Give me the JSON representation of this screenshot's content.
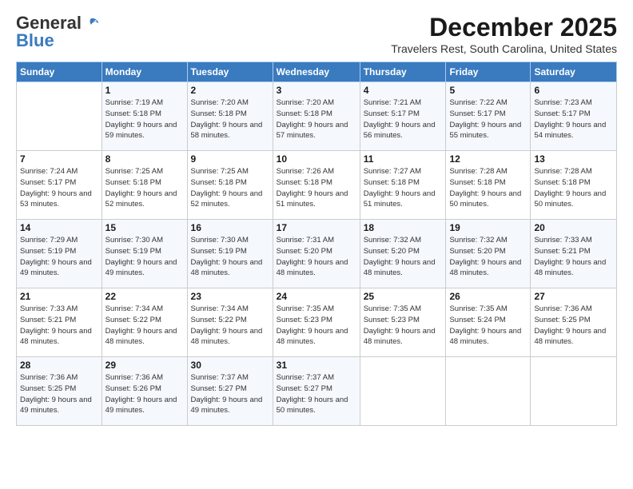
{
  "logo": {
    "general": "General",
    "blue": "Blue"
  },
  "header": {
    "month": "December 2025",
    "location": "Travelers Rest, South Carolina, United States"
  },
  "weekdays": [
    "Sunday",
    "Monday",
    "Tuesday",
    "Wednesday",
    "Thursday",
    "Friday",
    "Saturday"
  ],
  "weeks": [
    [
      {
        "day": "",
        "info": ""
      },
      {
        "day": "1",
        "info": "Sunrise: 7:19 AM\nSunset: 5:18 PM\nDaylight: 9 hours\nand 59 minutes."
      },
      {
        "day": "2",
        "info": "Sunrise: 7:20 AM\nSunset: 5:18 PM\nDaylight: 9 hours\nand 58 minutes."
      },
      {
        "day": "3",
        "info": "Sunrise: 7:20 AM\nSunset: 5:18 PM\nDaylight: 9 hours\nand 57 minutes."
      },
      {
        "day": "4",
        "info": "Sunrise: 7:21 AM\nSunset: 5:17 PM\nDaylight: 9 hours\nand 56 minutes."
      },
      {
        "day": "5",
        "info": "Sunrise: 7:22 AM\nSunset: 5:17 PM\nDaylight: 9 hours\nand 55 minutes."
      },
      {
        "day": "6",
        "info": "Sunrise: 7:23 AM\nSunset: 5:17 PM\nDaylight: 9 hours\nand 54 minutes."
      }
    ],
    [
      {
        "day": "7",
        "info": "Sunrise: 7:24 AM\nSunset: 5:17 PM\nDaylight: 9 hours\nand 53 minutes."
      },
      {
        "day": "8",
        "info": "Sunrise: 7:25 AM\nSunset: 5:18 PM\nDaylight: 9 hours\nand 52 minutes."
      },
      {
        "day": "9",
        "info": "Sunrise: 7:25 AM\nSunset: 5:18 PM\nDaylight: 9 hours\nand 52 minutes."
      },
      {
        "day": "10",
        "info": "Sunrise: 7:26 AM\nSunset: 5:18 PM\nDaylight: 9 hours\nand 51 minutes."
      },
      {
        "day": "11",
        "info": "Sunrise: 7:27 AM\nSunset: 5:18 PM\nDaylight: 9 hours\nand 51 minutes."
      },
      {
        "day": "12",
        "info": "Sunrise: 7:28 AM\nSunset: 5:18 PM\nDaylight: 9 hours\nand 50 minutes."
      },
      {
        "day": "13",
        "info": "Sunrise: 7:28 AM\nSunset: 5:18 PM\nDaylight: 9 hours\nand 50 minutes."
      }
    ],
    [
      {
        "day": "14",
        "info": "Sunrise: 7:29 AM\nSunset: 5:19 PM\nDaylight: 9 hours\nand 49 minutes."
      },
      {
        "day": "15",
        "info": "Sunrise: 7:30 AM\nSunset: 5:19 PM\nDaylight: 9 hours\nand 49 minutes."
      },
      {
        "day": "16",
        "info": "Sunrise: 7:30 AM\nSunset: 5:19 PM\nDaylight: 9 hours\nand 48 minutes."
      },
      {
        "day": "17",
        "info": "Sunrise: 7:31 AM\nSunset: 5:20 PM\nDaylight: 9 hours\nand 48 minutes."
      },
      {
        "day": "18",
        "info": "Sunrise: 7:32 AM\nSunset: 5:20 PM\nDaylight: 9 hours\nand 48 minutes."
      },
      {
        "day": "19",
        "info": "Sunrise: 7:32 AM\nSunset: 5:20 PM\nDaylight: 9 hours\nand 48 minutes."
      },
      {
        "day": "20",
        "info": "Sunrise: 7:33 AM\nSunset: 5:21 PM\nDaylight: 9 hours\nand 48 minutes."
      }
    ],
    [
      {
        "day": "21",
        "info": "Sunrise: 7:33 AM\nSunset: 5:21 PM\nDaylight: 9 hours\nand 48 minutes."
      },
      {
        "day": "22",
        "info": "Sunrise: 7:34 AM\nSunset: 5:22 PM\nDaylight: 9 hours\nand 48 minutes."
      },
      {
        "day": "23",
        "info": "Sunrise: 7:34 AM\nSunset: 5:22 PM\nDaylight: 9 hours\nand 48 minutes."
      },
      {
        "day": "24",
        "info": "Sunrise: 7:35 AM\nSunset: 5:23 PM\nDaylight: 9 hours\nand 48 minutes."
      },
      {
        "day": "25",
        "info": "Sunrise: 7:35 AM\nSunset: 5:23 PM\nDaylight: 9 hours\nand 48 minutes."
      },
      {
        "day": "26",
        "info": "Sunrise: 7:35 AM\nSunset: 5:24 PM\nDaylight: 9 hours\nand 48 minutes."
      },
      {
        "day": "27",
        "info": "Sunrise: 7:36 AM\nSunset: 5:25 PM\nDaylight: 9 hours\nand 48 minutes."
      }
    ],
    [
      {
        "day": "28",
        "info": "Sunrise: 7:36 AM\nSunset: 5:25 PM\nDaylight: 9 hours\nand 49 minutes."
      },
      {
        "day": "29",
        "info": "Sunrise: 7:36 AM\nSunset: 5:26 PM\nDaylight: 9 hours\nand 49 minutes."
      },
      {
        "day": "30",
        "info": "Sunrise: 7:37 AM\nSunset: 5:27 PM\nDaylight: 9 hours\nand 49 minutes."
      },
      {
        "day": "31",
        "info": "Sunrise: 7:37 AM\nSunset: 5:27 PM\nDaylight: 9 hours\nand 50 minutes."
      },
      {
        "day": "",
        "info": ""
      },
      {
        "day": "",
        "info": ""
      },
      {
        "day": "",
        "info": ""
      }
    ]
  ]
}
